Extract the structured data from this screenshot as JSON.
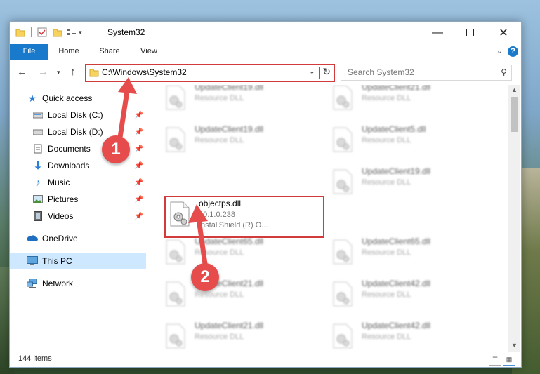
{
  "window": {
    "title": "System32"
  },
  "ribbon": {
    "tabs": [
      "File",
      "Home",
      "Share",
      "View"
    ],
    "help": "?"
  },
  "address": {
    "path": "C:\\Windows\\System32",
    "search_placeholder": "Search System32"
  },
  "nav": {
    "items": [
      {
        "label": "Quick access",
        "icon": "star-icon"
      },
      {
        "label": "Local Disk (C:)",
        "icon": "drive-icon",
        "pinned": true
      },
      {
        "label": "Local Disk (D:)",
        "icon": "drive-icon",
        "pinned": true
      },
      {
        "label": "Documents",
        "icon": "documents-icon",
        "pinned": true
      },
      {
        "label": "Downloads",
        "icon": "download-icon",
        "pinned": true
      },
      {
        "label": "Music",
        "icon": "music-icon",
        "pinned": true
      },
      {
        "label": "Pictures",
        "icon": "pictures-icon",
        "pinned": true
      },
      {
        "label": "Videos",
        "icon": "videos-icon",
        "pinned": true
      },
      {
        "label": "OneDrive",
        "icon": "cloud-icon"
      },
      {
        "label": "This PC",
        "icon": "computer-icon",
        "selected": true
      },
      {
        "label": "Network",
        "icon": "network-icon"
      }
    ]
  },
  "files": {
    "r0c0": {
      "name": "UpdateClient19.dll",
      "desc": "Resource DLL"
    },
    "r0c1": {
      "name": "UpdateClient21.dll",
      "desc": "Resource DLL"
    },
    "r1c0": {
      "name": "UpdateClient19.dll",
      "desc": "Resource DLL"
    },
    "r1c1": {
      "name": "UpdateClient5.dll",
      "desc": "Resource DLL"
    },
    "r2c0": {
      "name": "objectps.dll",
      "version": "10.1.0.238",
      "desc": "InstallShield (R) O..."
    },
    "r2c1": {
      "name": "UpdateClient19.dll",
      "desc": "Resource DLL"
    },
    "r3c0": {
      "name": "UpdateClient65.dll",
      "desc": "Resource DLL"
    },
    "r3c1": {
      "name": "UpdateClient65.dll",
      "desc": "Resource DLL"
    },
    "r4c0": {
      "name": "UpdateClient21.dll",
      "desc": "Resource DLL"
    },
    "r4c1": {
      "name": "UpdateClient42.dll",
      "desc": "Resource DLL"
    },
    "r5c0": {
      "name": "UpdateClient21.dll",
      "desc": "Resource DLL"
    },
    "r5c1": {
      "name": "UpdateClient42.dll",
      "desc": "Resource DLL"
    }
  },
  "status": {
    "count": "144 items"
  },
  "callouts": {
    "one": "1",
    "two": "2"
  },
  "colors": {
    "accent": "#1979ca",
    "annotation": "#d23b3b",
    "callout": "#e74c4c"
  }
}
